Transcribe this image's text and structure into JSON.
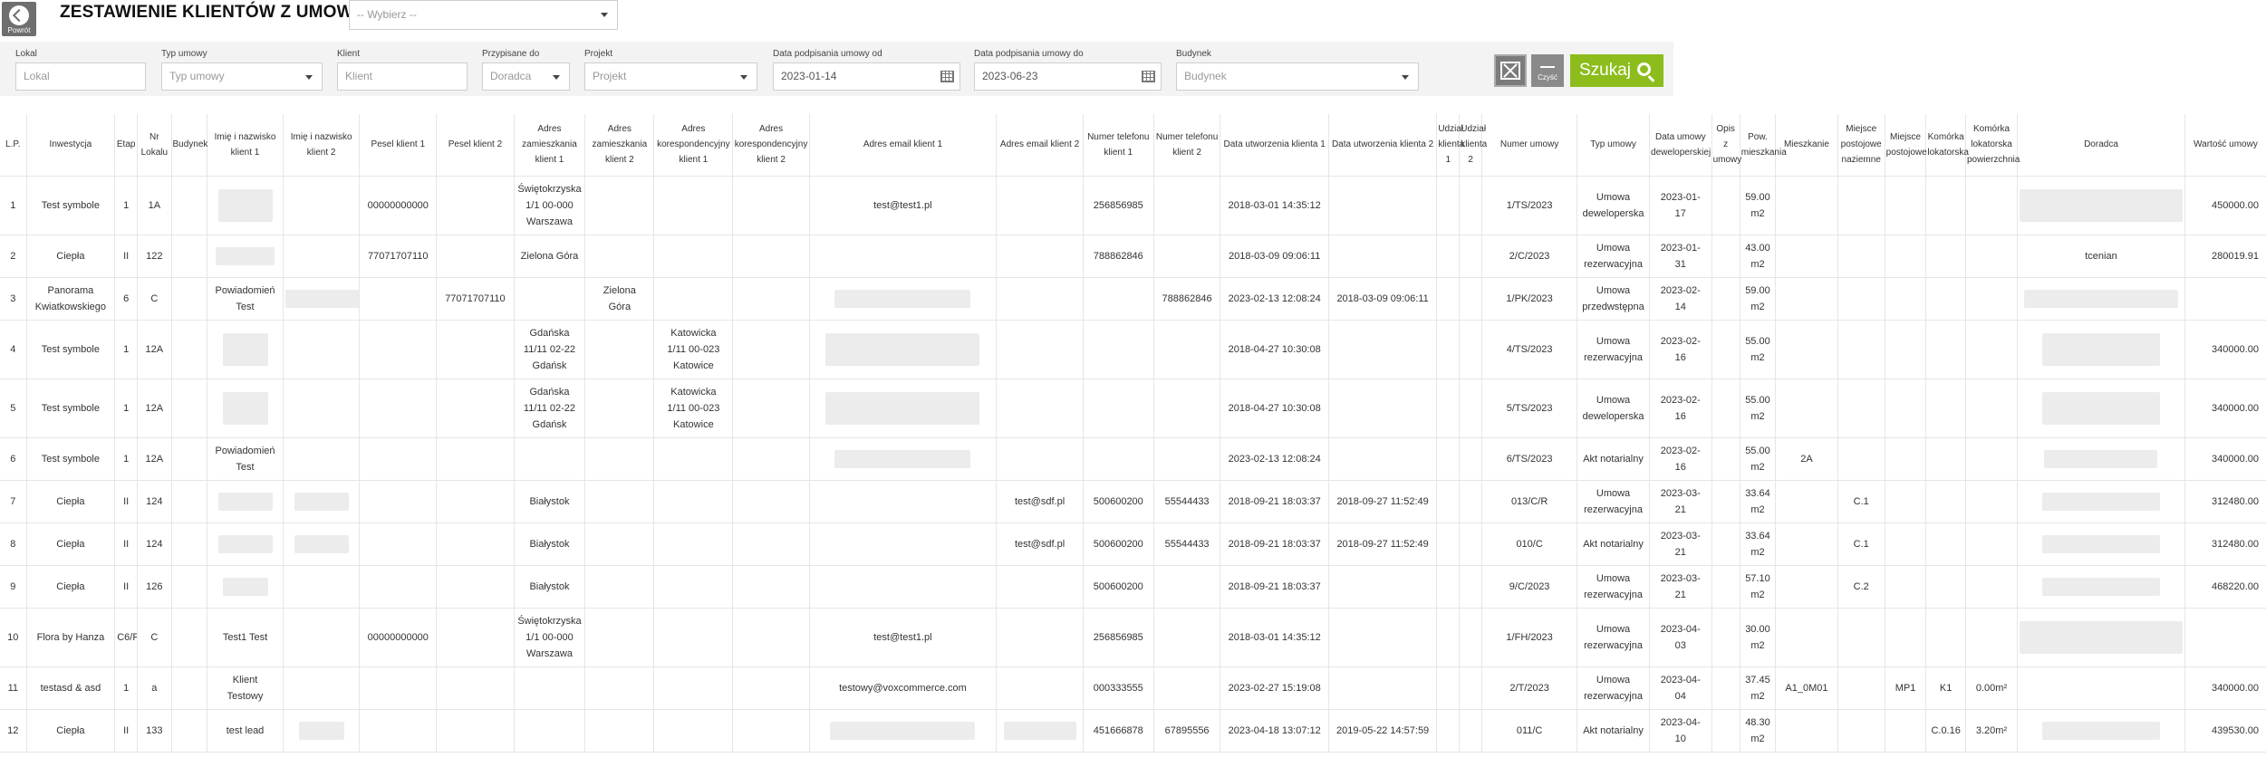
{
  "header": {
    "back_label": "Powrót",
    "title": "ZESTAWIENIE KLIENTÓW Z UMOWĄ",
    "select_placeholder": "-- Wybierz --"
  },
  "filters": {
    "lokal": {
      "label": "Lokal",
      "placeholder": "Lokal"
    },
    "typ_umowy": {
      "label": "Typ umowy",
      "placeholder": "Typ umowy"
    },
    "klient": {
      "label": "Klient",
      "placeholder": "Klient"
    },
    "przypisane_do": {
      "label": "Przypisane do",
      "placeholder": "Doradca"
    },
    "projekt": {
      "label": "Projekt",
      "placeholder": "Projekt"
    },
    "data_od": {
      "label": "Data podpisania umowy od",
      "value": "2023-01-14"
    },
    "data_do": {
      "label": "Data podpisania umowy do",
      "value": "2023-06-23"
    },
    "budynek": {
      "label": "Budynek",
      "placeholder": "Budynek"
    }
  },
  "actions": {
    "clear_label": "Czyść",
    "search_label": "Szukaj"
  },
  "table": {
    "headers": [
      "L.P.",
      "Inwestycja",
      "Etap",
      "Nr Lokalu",
      "Budynek",
      "Imię i nazwisko klient 1",
      "Imię i nazwisko klient 2",
      "Pesel klient 1",
      "Pesel klient 2",
      "Adres zamieszkania klient 1",
      "Adres zamieszkania klient 2",
      "Adres korespondencyjny klient 1",
      "Adres korespondencyjny klient 2",
      "Adres email klient 1",
      "Adres email klient 2",
      "Numer telefonu klient 1",
      "Numer telefonu klient 2",
      "Data utworzenia klienta 1",
      "Data utworzenia klienta 2",
      "Udział klienta 1",
      "Udział klienta 2",
      "Numer umowy",
      "Typ umowy",
      "Data umowy deweloperskiej",
      "Opis z umowy",
      "Pow. mieszkania",
      "Mieszkanie",
      "Miejsce postojowe naziemne",
      "Miejsce postojowe",
      "Komórka lokatorska",
      "Komórka lokatorska powierzchnia",
      "Doradca",
      "Wartość umowy"
    ],
    "rows": [
      [
        "1",
        "Test symbole",
        "1",
        "1A",
        "",
        "",
        "",
        "00000000000",
        "",
        "Świętokrzyska\n1/1 00-000\nWarszawa",
        "",
        "",
        "",
        "test@test1.pl",
        "",
        "256856985",
        "",
        "2018-03-01 14:35:12",
        "",
        "",
        "",
        "1/TS/2023",
        "Umowa\ndeweloperska",
        "2023-01-\n17",
        "",
        "59.00\nm2",
        "",
        "",
        "",
        "",
        "",
        "",
        "450000.00"
      ],
      [
        "2",
        "Ciepła",
        "II",
        "122",
        "",
        "",
        "",
        "77071707110",
        "",
        "Zielona Góra",
        "",
        "",
        "",
        "",
        "",
        "788862846",
        "",
        "2018-03-09 09:06:11",
        "",
        "",
        "",
        "2/C/2023",
        "Umowa\nrezerwacyjna",
        "2023-01-\n31",
        "",
        "43.00\nm2",
        "",
        "",
        "",
        "",
        "",
        "tcenian",
        "280019.91"
      ],
      [
        "3",
        "Panorama\nKwiatkowskiego",
        "6",
        "C",
        "",
        "Powiadomień\nTest",
        "",
        "",
        "77071707110",
        "",
        "Zielona\nGóra",
        "",
        "",
        "",
        "",
        "",
        "788862846",
        "2023-02-13 12:08:24",
        "2018-03-09 09:06:11",
        "",
        "",
        "1/PK/2023",
        "Umowa\nprzedwstępna",
        "2023-02-\n14",
        "",
        "59.00\nm2",
        "",
        "",
        "",
        "",
        "",
        "",
        ""
      ],
      [
        "4",
        "Test symbole",
        "1",
        "12A",
        "",
        "",
        "",
        "",
        "",
        "Gdańska\n11/11 02-22\nGdańsk",
        "",
        "Katowicka\n1/11 00-023\nKatowice",
        "",
        "",
        "",
        "",
        "",
        "2018-04-27 10:30:08",
        "",
        "",
        "",
        "4/TS/2023",
        "Umowa\nrezerwacyjna",
        "2023-02-\n16",
        "",
        "55.00\nm2",
        "",
        "",
        "",
        "",
        "",
        "",
        "340000.00"
      ],
      [
        "5",
        "Test symbole",
        "1",
        "12A",
        "",
        "",
        "",
        "",
        "",
        "Gdańska\n11/11 02-22\nGdańsk",
        "",
        "Katowicka\n1/11 00-023\nKatowice",
        "",
        "",
        "",
        "",
        "",
        "2018-04-27 10:30:08",
        "",
        "",
        "",
        "5/TS/2023",
        "Umowa\ndeweloperska",
        "2023-02-\n16",
        "",
        "55.00\nm2",
        "",
        "",
        "",
        "",
        "",
        "",
        "340000.00"
      ],
      [
        "6",
        "Test symbole",
        "1",
        "12A",
        "",
        "Powiadomień\nTest",
        "",
        "",
        "",
        "",
        "",
        "",
        "",
        "",
        "",
        "",
        "",
        "2023-02-13 12:08:24",
        "",
        "",
        "",
        "6/TS/2023",
        "Akt notarialny",
        "2023-02-\n16",
        "",
        "55.00\nm2",
        "2A",
        "",
        "",
        "",
        "",
        "",
        "340000.00"
      ],
      [
        "7",
        "Ciepła",
        "II",
        "124",
        "",
        "",
        "",
        "",
        "",
        "Białystok",
        "",
        "",
        "",
        "",
        "test@sdf.pl",
        "500600200",
        "55544433",
        "2018-09-21 18:03:37",
        "2018-09-27 11:52:49",
        "",
        "",
        "013/C/R",
        "Umowa\nrezerwacyjna",
        "2023-03-\n21",
        "",
        "33.64\nm2",
        "",
        "C.1",
        "",
        "",
        "",
        "",
        "312480.00"
      ],
      [
        "8",
        "Ciepła",
        "II",
        "124",
        "",
        "",
        "",
        "",
        "",
        "Białystok",
        "",
        "",
        "",
        "",
        "test@sdf.pl",
        "500600200",
        "55544433",
        "2018-09-21 18:03:37",
        "2018-09-27 11:52:49",
        "",
        "",
        "010/C",
        "Akt notarialny",
        "2023-03-\n21",
        "",
        "33.64\nm2",
        "",
        "C.1",
        "",
        "",
        "",
        "",
        "312480.00"
      ],
      [
        "9",
        "Ciepła",
        "II",
        "126",
        "",
        "",
        "",
        "",
        "",
        "Białystok",
        "",
        "",
        "",
        "",
        "",
        "500600200",
        "",
        "2018-09-21 18:03:37",
        "",
        "",
        "",
        "9/C/2023",
        "Umowa\nrezerwacyjna",
        "2023-03-\n21",
        "",
        "57.10\nm2",
        "",
        "C.2",
        "",
        "",
        "",
        "",
        "468220.00"
      ],
      [
        "10",
        "Flora by Hanza",
        "C6/P",
        "C",
        "",
        "Test1 Test",
        "",
        "00000000000",
        "",
        "Świętokrzyska\n1/1 00-000\nWarszawa",
        "",
        "",
        "",
        "test@test1.pl",
        "",
        "256856985",
        "",
        "2018-03-01 14:35:12",
        "",
        "",
        "",
        "1/FH/2023",
        "Umowa\nrezerwacyjna",
        "2023-04-\n03",
        "",
        "30.00\nm2",
        "",
        "",
        "",
        "",
        "",
        "",
        ""
      ],
      [
        "11",
        "testasd & asd",
        "1",
        "a",
        "",
        "Klient\nTestowy",
        "",
        "",
        "",
        "",
        "",
        "",
        "",
        "testowy@voxcommerce.com",
        "",
        "000333555",
        "",
        "2023-02-27 15:19:08",
        "",
        "",
        "",
        "2/T/2023",
        "Umowa\nrezerwacyjna",
        "2023-04-\n04",
        "",
        "37.45\nm2",
        "A1_0M01",
        "",
        "MP1",
        "K1",
        "0.00m²",
        "",
        "340000.00"
      ],
      [
        "12",
        "Ciepła",
        "II",
        "133",
        "",
        "test lead",
        "",
        "",
        "",
        "",
        "",
        "",
        "",
        "",
        "",
        "451666878",
        "67895556",
        "2023-04-18 13:07:12",
        "2019-05-22 14:57:59",
        "",
        "",
        "011/C",
        "Akt notarialny",
        "2023-04-\n10",
        "",
        "48.30\nm2",
        "",
        "",
        "",
        "C.0.16",
        "3.20m²",
        "",
        "439530.00"
      ]
    ]
  }
}
